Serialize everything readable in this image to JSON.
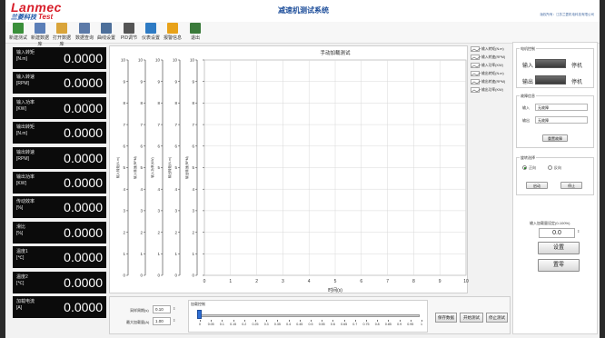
{
  "header": {
    "logo_brand": "Lanmec",
    "logo_sub_cn": "兰菱科技",
    "logo_sub_en": "Test",
    "title": "减速机测试系统",
    "right_info": "版权所有：江苏兰菱机电科技有限公司"
  },
  "toolbar": [
    {
      "label": "新建测试",
      "icon": "new-test-icon",
      "color": "#3a8f3a"
    },
    {
      "label": "新建数据库",
      "icon": "new-db-icon",
      "color": "#5b7fb8"
    },
    {
      "label": "打开数据库",
      "icon": "open-db-icon",
      "color": "#d9a43a"
    },
    {
      "label": "数据查询",
      "icon": "query-icon",
      "color": "#5c7aa8"
    },
    {
      "label": "曲线设置",
      "icon": "curve-settings-icon",
      "color": "#4d6f9a"
    },
    {
      "label": "PID调节",
      "icon": "pid-icon",
      "color": "#555555"
    },
    {
      "label": "仪表设置",
      "icon": "meter-icon",
      "color": "#2e7bc4"
    },
    {
      "label": "报警信息",
      "icon": "alarm-icon",
      "color": "#e8a21a"
    },
    {
      "label": "退出",
      "icon": "exit-icon",
      "color": "#3a7a3a"
    }
  ],
  "readouts": [
    {
      "label": "输入转矩",
      "unit": "[N.m]",
      "value": "0.0000"
    },
    {
      "label": "输入转速",
      "unit": "[RPM]",
      "value": "0.0000"
    },
    {
      "label": "输入功率",
      "unit": "[KW]",
      "value": "0.0000"
    },
    {
      "label": "输出转矩",
      "unit": "[N.m]",
      "value": "0.0000"
    },
    {
      "label": "输出转速",
      "unit": "[RPM]",
      "value": "0.0000"
    },
    {
      "label": "输出功率",
      "unit": "[KW]",
      "value": "0.0000"
    },
    {
      "label": "传动效率",
      "unit": "[%]",
      "value": "0.0000"
    },
    {
      "label": "滑比",
      "unit": "[%]",
      "value": "0.0000"
    },
    {
      "label": "温度1",
      "unit": "[℃]",
      "value": "0.0000"
    },
    {
      "label": "温度2",
      "unit": "[℃]",
      "value": "0.0000"
    },
    {
      "label": "加载电流",
      "unit": "[A]",
      "value": "0.0000"
    }
  ],
  "chart_data": {
    "type": "line",
    "title": "手动加载测试",
    "xlabel": "时间(s)",
    "xlim": [
      0,
      10
    ],
    "x_ticks": [
      "0",
      "1",
      "2",
      "3",
      "4",
      "5",
      "6",
      "7",
      "8",
      "9",
      "10"
    ],
    "ylim": [
      0,
      10
    ],
    "y_ticks": [
      "0",
      "1",
      "2",
      "3",
      "4",
      "5",
      "6",
      "7",
      "8",
      "9",
      "10"
    ],
    "axis_labels": [
      "输入转矩(N.m)",
      "输入转速(RPM)",
      "输入功率(KW)",
      "输出转矩(N.m)",
      "输出转速(RPM)"
    ],
    "grid": true,
    "series": [
      {
        "name": "输入转矩(N.m)",
        "values": []
      },
      {
        "name": "输入转速(RPM)",
        "values": []
      },
      {
        "name": "输入功率(KW)",
        "values": []
      },
      {
        "name": "输出转矩(N.m)",
        "values": []
      },
      {
        "name": "输出转速(RPM)",
        "values": []
      },
      {
        "name": "输出功率(KW)",
        "values": []
      }
    ]
  },
  "right": {
    "motor_group_title": "电机控制",
    "input_label": "输入",
    "input_status": "停机",
    "output_label": "输出",
    "output_status": "停机",
    "info_group_title": "故障信息",
    "fault_in_label": "输入",
    "fault_in_value": "无故障",
    "fault_out_label": "输出",
    "fault_out_value": "无故障",
    "reset_fault_label": "重置故障",
    "dir_group_title": "旋转选择",
    "dir_forward": "正向",
    "dir_reverse": "反向",
    "start_label": "启动",
    "stop_label": "停止",
    "load_title": "输入加载量设定(0-100%)",
    "load_value": "0.0",
    "set_label": "设置",
    "clear_label": "置零"
  },
  "bottom": {
    "sample_label": "采样周期(s)",
    "sample_value": "0.10",
    "max_load_label": "最大加载量(A)",
    "max_load_value": "1.00",
    "slider_title": "加载控制",
    "slider_ticks": [
      "0",
      "0.05",
      "0.1",
      "0.15",
      "0.2",
      "0.25",
      "0.3",
      "0.35",
      "0.4",
      "0.45",
      "0.5",
      "0.55",
      "0.6",
      "0.65",
      "0.7",
      "0.75",
      "0.8",
      "0.85",
      "0.9",
      "0.95",
      "1"
    ],
    "slider_value": 0,
    "btn_save": "保存数据",
    "btn_start": "开始测试",
    "btn_stop": "停止测试"
  }
}
